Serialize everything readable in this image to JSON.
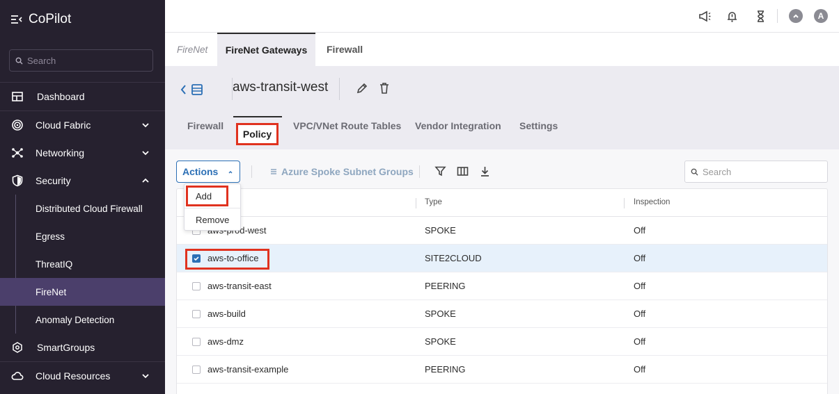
{
  "app": {
    "name": "CoPilot"
  },
  "sidebar": {
    "search_placeholder": "Search",
    "items": [
      {
        "label": "Dashboard",
        "icon": "dashboard-icon"
      },
      {
        "label": "Cloud Fabric",
        "icon": "cloud-fabric-icon"
      },
      {
        "label": "Networking",
        "icon": "networking-icon"
      },
      {
        "label": "Security",
        "icon": "shield-icon"
      },
      {
        "label": "SmartGroups",
        "icon": "smartgroups-icon"
      },
      {
        "label": "Cloud Resources",
        "icon": "cloud-icon"
      }
    ],
    "security_sub": [
      {
        "label": "Distributed Cloud Firewall"
      },
      {
        "label": "Egress"
      },
      {
        "label": "ThreatIQ"
      },
      {
        "label": "FireNet",
        "active": true
      },
      {
        "label": "Anomaly Detection"
      }
    ]
  },
  "topbar": {
    "avatar_letter": "A"
  },
  "page_tabs": {
    "crumb": "FireNet",
    "active": "FireNet Gateways",
    "other": "Firewall"
  },
  "gateway": {
    "name": "aws-transit-west"
  },
  "sub_tabs": {
    "firewall": "Firewall",
    "policy": "Policy",
    "route_tables": "VPC/VNet Route Tables",
    "vendor": "Vendor Integration",
    "settings": "Settings"
  },
  "toolbar": {
    "actions_label": "Actions",
    "azure_link": "Azure Spoke Subnet Groups",
    "search_placeholder": "Search"
  },
  "actions_menu": {
    "add": "Add",
    "remove": "Remove"
  },
  "table": {
    "columns": {
      "type": "Type",
      "inspection": "Inspection"
    },
    "rows": [
      {
        "name": "aws-prod-west",
        "type": "SPOKE",
        "inspection": "Off",
        "checked": false
      },
      {
        "name": "aws-to-office",
        "type": "SITE2CLOUD",
        "inspection": "Off",
        "checked": true
      },
      {
        "name": "aws-transit-east",
        "type": "PEERING",
        "inspection": "Off",
        "checked": false
      },
      {
        "name": "aws-build",
        "type": "SPOKE",
        "inspection": "Off",
        "checked": false
      },
      {
        "name": "aws-dmz",
        "type": "SPOKE",
        "inspection": "Off",
        "checked": false
      },
      {
        "name": "aws-transit-example",
        "type": "PEERING",
        "inspection": "Off",
        "checked": false
      }
    ]
  },
  "colors": {
    "accent": "#2b6fb5",
    "highlight": "#e0321f",
    "sidebar_bg": "#26212f",
    "active_nav": "#4b3f6b"
  }
}
